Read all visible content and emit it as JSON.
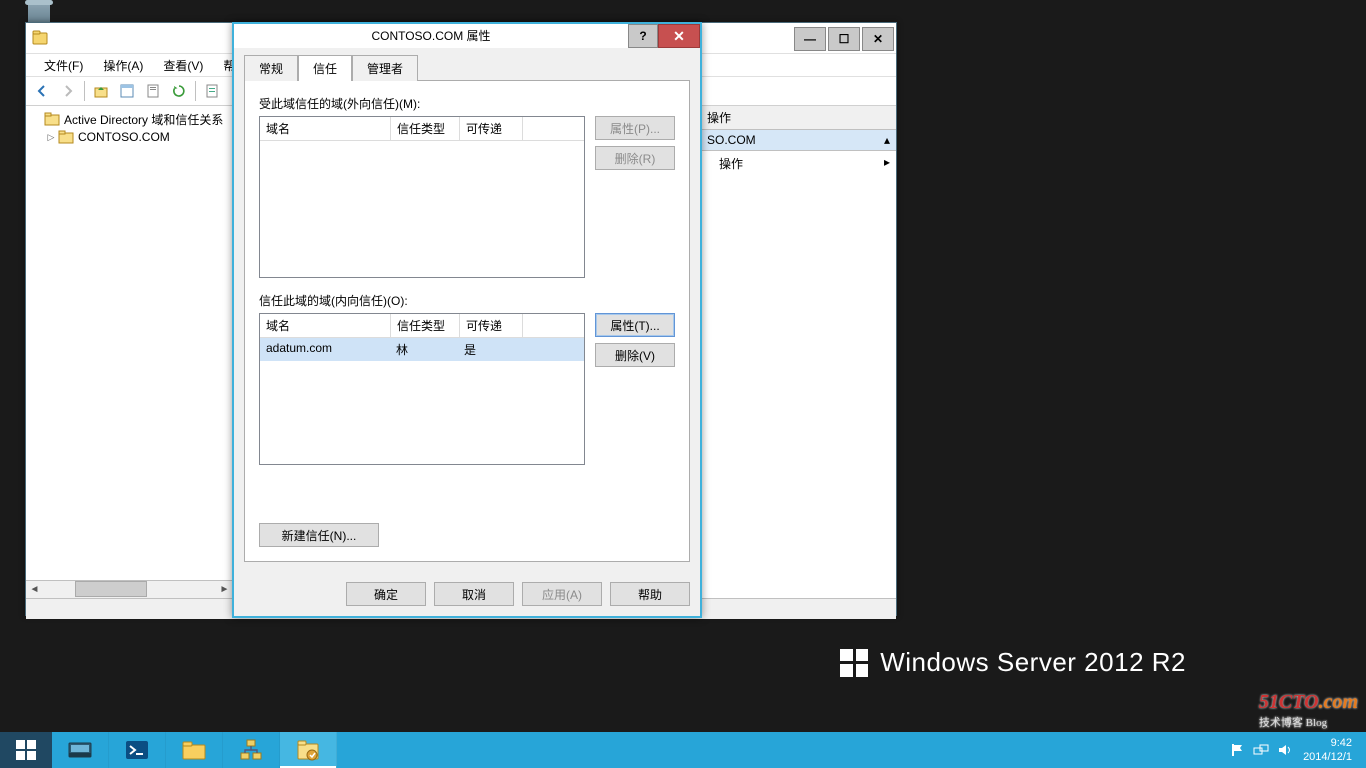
{
  "desktop": {
    "os_watermark": "Windows Server 2012 R2"
  },
  "mmc": {
    "title": "",
    "menu": {
      "file": "文件(F)",
      "action": "操作(A)",
      "view": "查看(V)",
      "help": "帮助"
    },
    "tree": {
      "root": "Active Directory 域和信任关系",
      "child": "CONTOSO.COM"
    },
    "actions": {
      "header": "操作",
      "context": "SO.COM",
      "more": "操作"
    }
  },
  "dialog": {
    "title": "CONTOSO.COM 属性",
    "tabs": {
      "general": "常规",
      "trust": "信任",
      "managedby": "管理者"
    },
    "outgoing_label": "受此域信任的域(外向信任)(M):",
    "incoming_label": "信任此域的域(内向信任)(O):",
    "columns": {
      "domain": "域名",
      "type": "信任类型",
      "transitive": "可传递"
    },
    "incoming_rows": [
      {
        "domain": "adatum.com",
        "type": "林",
        "transitive": "是"
      }
    ],
    "buttons": {
      "properties_p": "属性(P)...",
      "remove_r": "删除(R)",
      "properties_t": "属性(T)...",
      "remove_v": "删除(V)",
      "new_trust": "新建信任(N)...",
      "ok": "确定",
      "cancel": "取消",
      "apply": "应用(A)",
      "help": "帮助"
    }
  },
  "taskbar": {
    "clock_time": "9:42",
    "clock_date": "2014/12/1"
  },
  "watermark_site": {
    "line1": "51CTO",
    "line2": ".com",
    "sub": "技术博客 Blog"
  }
}
